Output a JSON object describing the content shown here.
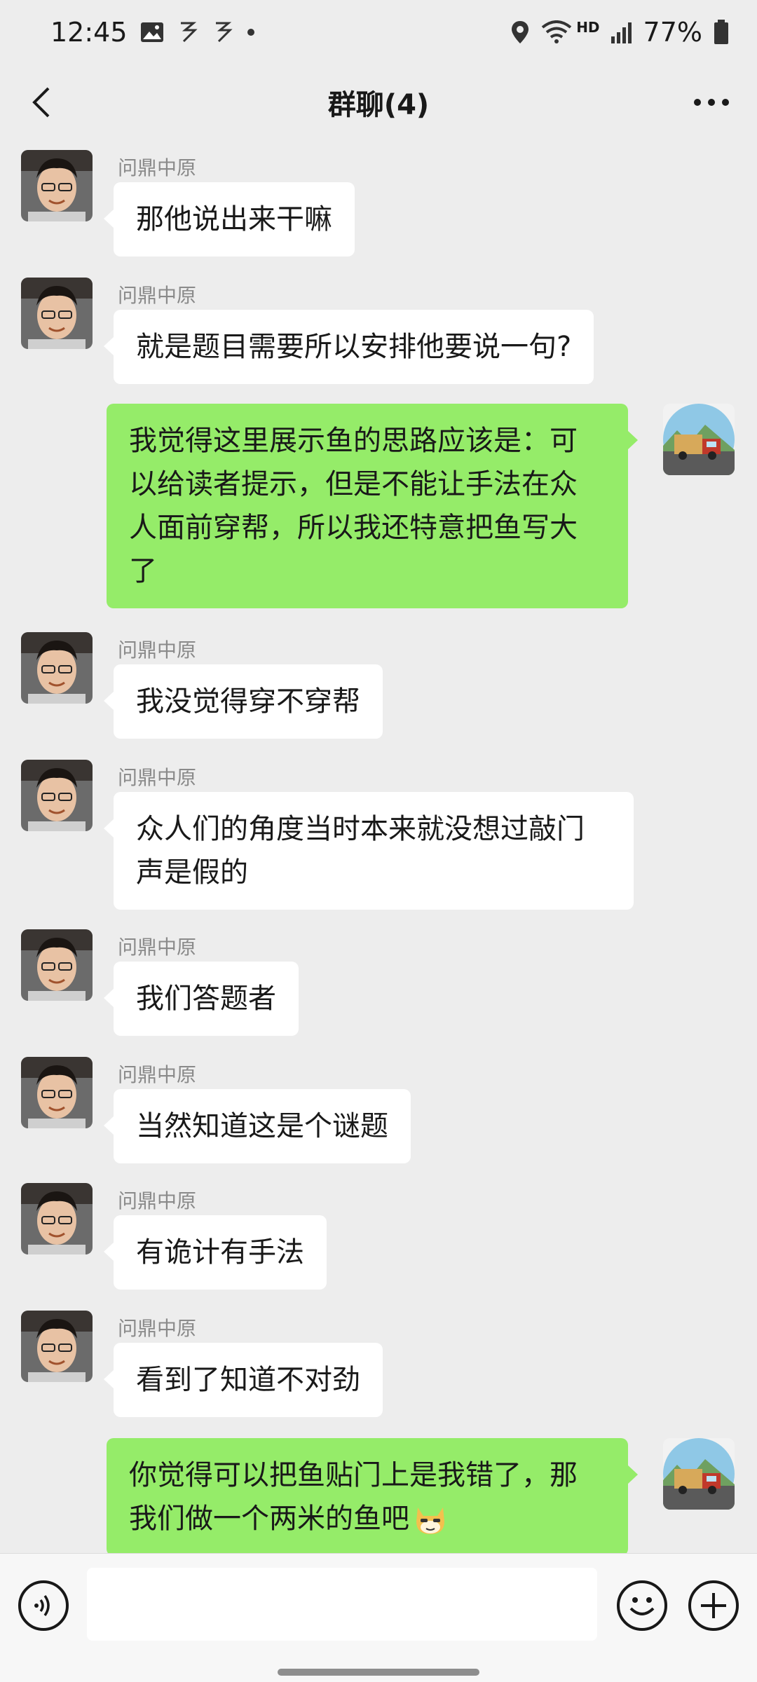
{
  "status_bar": {
    "time": "12:45",
    "battery": "77%",
    "network": "HD"
  },
  "nav": {
    "title": "群聊(4)"
  },
  "messages": [
    {
      "side": "in",
      "sender": "问鼎中原",
      "text": "那他说出来干嘛"
    },
    {
      "side": "in",
      "sender": "问鼎中原",
      "text": "就是题目需要所以安排他要说一句?"
    },
    {
      "side": "out",
      "lines": [
        "我觉得这里展示鱼的思路应该是：可",
        "以给读者提示，但是不能让手法在众",
        "人面前穿帮，所以我还特意把鱼写大",
        "了"
      ]
    },
    {
      "side": "in",
      "sender": "问鼎中原",
      "text": "我没觉得穿不穿帮"
    },
    {
      "side": "in",
      "sender": "问鼎中原",
      "lines": [
        "众人们的角度当时本来就没想过敲门",
        "声是假的"
      ]
    },
    {
      "side": "in",
      "sender": "问鼎中原",
      "text": "我们答题者"
    },
    {
      "side": "in",
      "sender": "问鼎中原",
      "text": "当然知道这是个谜题"
    },
    {
      "side": "in",
      "sender": "问鼎中原",
      "text": "有诡计有手法"
    },
    {
      "side": "in",
      "sender": "问鼎中原",
      "text": "看到了知道不对劲"
    },
    {
      "side": "out",
      "lines": [
        "你觉得可以把鱼贴门上是我错了，那",
        "我们做一个两米的鱼吧"
      ],
      "emoji": "doge-emoji"
    }
  ],
  "colors": {
    "background": "#ededed",
    "bubble_out": "#95ec69",
    "bubble_in": "#ffffff",
    "sender_name": "#8a8a8a"
  },
  "icons": {
    "back": "chevron-left-icon",
    "more": "more-dots-icon",
    "voice": "voice-icon",
    "emoji": "smiley-icon",
    "plus": "plus-icon"
  }
}
